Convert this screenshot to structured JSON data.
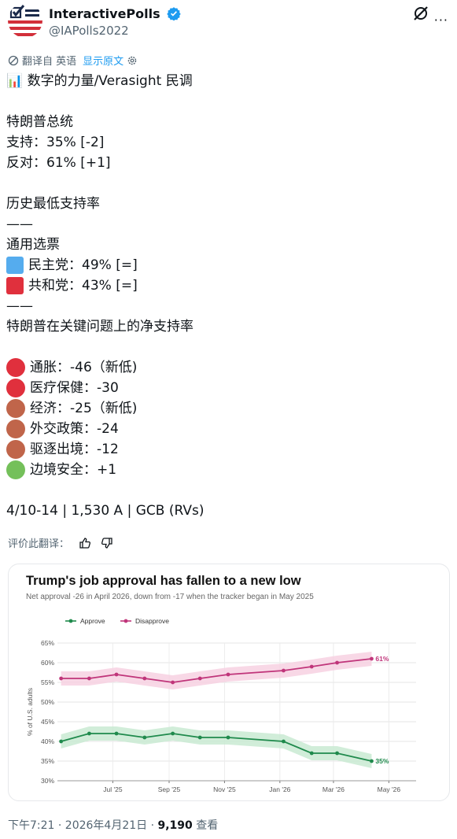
{
  "account": {
    "display_name": "InteractivePolls",
    "handle": "@IAPolls2022"
  },
  "translation": {
    "translated_from": "翻译自 英语",
    "show_original": "显示原文"
  },
  "tweet": {
    "headline": "📊 数字的力量/Verasight 民调",
    "president_heading": "特朗普总统",
    "approve_line": "支持：35% [-2]",
    "disapprove_line": "反对：61% [+1]",
    "record_low": "历史最低支持率",
    "divider": "——",
    "generic_ballot_heading": "通用选票",
    "dem_line": "民主党：49% [=]",
    "rep_line": "共和党：43% [=]",
    "issues_heading": "特朗普在关键问题上的净支持率",
    "issues": [
      {
        "label": "通胀：-46（新低)",
        "color": "#e0303d"
      },
      {
        "label": "医疗保健：-30",
        "color": "#e0303d"
      },
      {
        "label": "经济：-25（新低)",
        "color": "#c0654a"
      },
      {
        "label": "外交政策：-24",
        "color": "#c0654a"
      },
      {
        "label": "驱逐出境：-12",
        "color": "#c0654a"
      },
      {
        "label": "边境安全：+1",
        "color": "#74c05a"
      }
    ],
    "dem_color": "#55acee",
    "rep_color": "#e0303d",
    "meta": "4/10-14 | 1,530 A | GCB (RVs)"
  },
  "rate_translation": "评价此翻译：",
  "footer": {
    "time": "下午7:21 · 2026年4月21日 · ",
    "views": "9,190",
    "views_label": " 查看"
  },
  "chart_data": {
    "type": "line",
    "title": "Trump's job approval has fallen to a new low",
    "subtitle": "Net approval -26 in April 2026, down from -17 when the tracker began in May 2025",
    "xlabel": "",
    "ylabel": "% of U.S. adults",
    "ylim": [
      30,
      65
    ],
    "yticks": [
      30,
      35,
      40,
      45,
      50,
      55,
      60,
      65
    ],
    "ytick_labels": [
      "30%",
      "35%",
      "40%",
      "45%",
      "50%",
      "55%",
      "60%",
      "65%"
    ],
    "x_range": [
      "2025-05-01",
      "2026-05-31"
    ],
    "xticks": [
      "2025-07-01",
      "2025-09-01",
      "2025-11-01",
      "2026-01-01",
      "2026-03-01",
      "2026-05-01"
    ],
    "xtick_labels": [
      "Jul '25",
      "Sep '25",
      "Nov '25",
      "Jan '26",
      "Mar '26",
      "May '26"
    ],
    "legend": "top-left",
    "grid": true,
    "x": [
      "2025-05-05",
      "2025-06-05",
      "2025-07-05",
      "2025-08-05",
      "2025-09-05",
      "2025-10-05",
      "2025-11-05",
      "2026-01-05",
      "2026-02-05",
      "2026-03-05",
      "2026-04-12"
    ],
    "series": [
      {
        "name": "Approve",
        "color": "#1f8a4c",
        "band_color": "#c9ead2",
        "values": [
          40,
          42,
          42,
          41,
          42,
          41,
          41,
          40,
          37,
          37,
          35
        ],
        "end_label": "35%"
      },
      {
        "name": "Disapprove",
        "color": "#c0357a",
        "band_color": "#f7d1e2",
        "values": [
          56,
          56,
          57,
          56,
          55,
          56,
          57,
          58,
          59,
          60,
          61
        ],
        "end_label": "61%"
      }
    ]
  }
}
